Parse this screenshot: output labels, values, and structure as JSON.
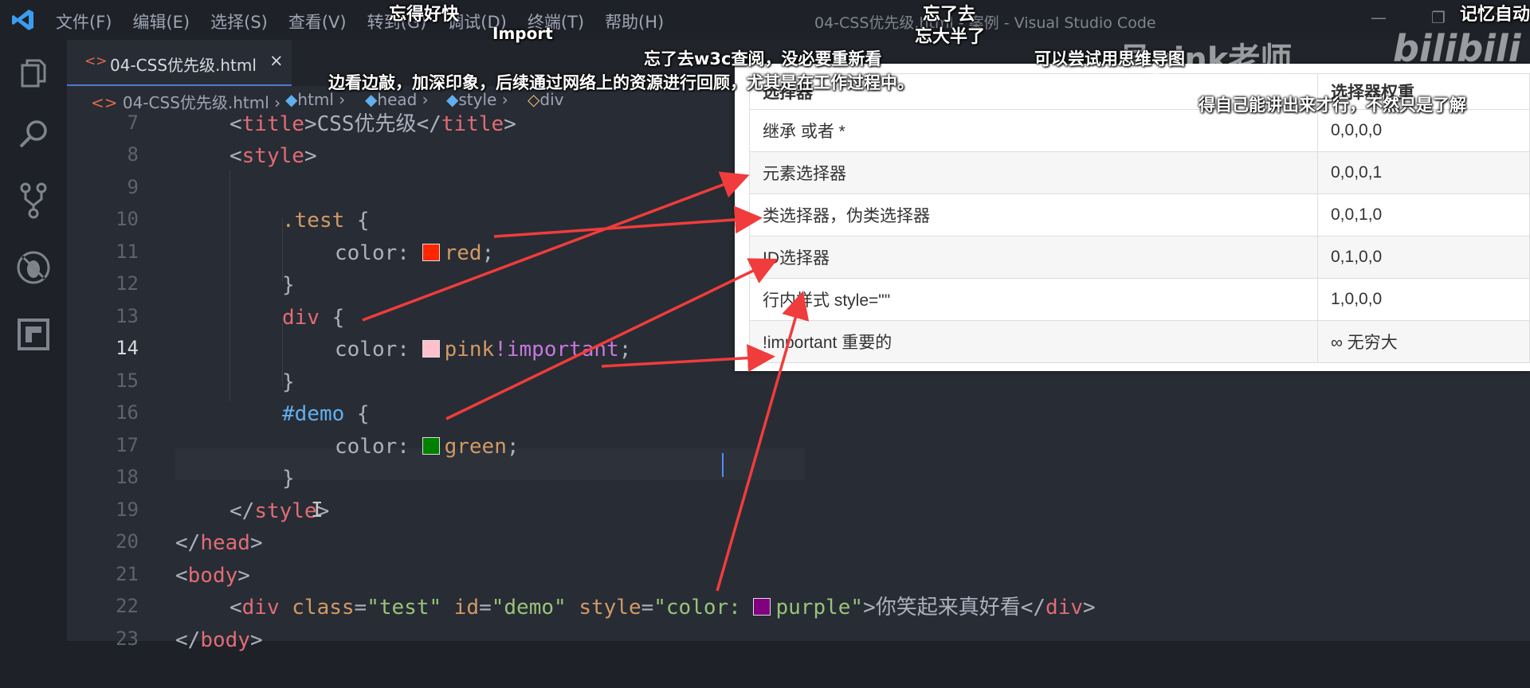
{
  "window": {
    "title": "04-CSS优先级.html - 案例 - Visual Studio Code",
    "menu": [
      "文件(F)",
      "编辑(E)",
      "选择(S)",
      "查看(V)",
      "转到(G)",
      "调试(D)",
      "终端(T)",
      "帮助(H)"
    ],
    "minimize": "—",
    "maximize": "❐",
    "close": "✕"
  },
  "tab": {
    "icon": "<>",
    "name": "04-CSS优先级.html",
    "close": "×"
  },
  "breadcrumb": [
    {
      "icon": "<>",
      "label": "04-CSS优先级.html"
    },
    {
      "icon": "◆",
      "label": "html"
    },
    {
      "icon": "◆",
      "label": "head"
    },
    {
      "icon": "◆",
      "label": "style"
    },
    {
      "icon": "◇",
      "label": "div"
    }
  ],
  "editor": {
    "line_numbers": [
      "7",
      "8",
      "9",
      "10",
      "11",
      "12",
      "13",
      "14",
      "15",
      "16",
      "17",
      "18",
      "19",
      "20",
      "21",
      "22",
      "23"
    ],
    "active_line": "14",
    "code": {
      "l7": {
        "open": "<",
        "tag": "title",
        "close": ">",
        "text": "CSS优先级",
        "end_open": "</",
        "end_tag": "title",
        "end_close": ">"
      },
      "l8": {
        "open": "<",
        "tag": "style",
        "close": ">"
      },
      "l10": {
        "sel": ".test",
        "brace": " {"
      },
      "l11": {
        "prop": "color: ",
        "val": "red",
        "semi": ";",
        "swatch": "#ff2600"
      },
      "l12": {
        "brace": "}"
      },
      "l13": {
        "sel": "div",
        "brace": " {"
      },
      "l14": {
        "prop": "color: ",
        "val": "pink",
        "imp": "!important",
        "semi": ";",
        "swatch": "#ffc0cb"
      },
      "l15": {
        "brace": "}"
      },
      "l16": {
        "sel": "#demo",
        "brace": " {"
      },
      "l17": {
        "prop": "color: ",
        "val": "green",
        "semi": ";",
        "swatch": "#008000"
      },
      "l18": {
        "brace": "}"
      },
      "l19": {
        "open": "</",
        "tag": "style",
        "close": ">"
      },
      "l20": {
        "open": "</",
        "tag": "head",
        "close": ">"
      },
      "l21": {
        "open": "<",
        "tag": "body",
        "close": ">"
      },
      "l22": {
        "open": "<",
        "tag": "div",
        "a1": " class",
        "eq1": "=",
        "v1": "\"test\"",
        "a2": " id",
        "eq2": "=",
        "v2": "\"demo\"",
        "a3": " style",
        "eq3": "=",
        "v3a": "\"color: ",
        "v3b": "purple\"",
        "swatch": "#800080",
        "close": ">",
        "text": "你笑起来真好看",
        "end_open": "</",
        "end_tag": "div",
        "end_close": ">"
      },
      "l23": {
        "open": "</",
        "tag": "body",
        "close": ">"
      }
    }
  },
  "specificity_table": {
    "headers": [
      "选择器",
      "选择器权重"
    ],
    "rows": [
      [
        "继承 或者 *",
        "0,0,0,0"
      ],
      [
        "元素选择器",
        "0,0,0,1"
      ],
      [
        "类选择器，伪类选择器",
        "0,0,1,0"
      ],
      [
        "ID选择器",
        "0,1,0,0"
      ],
      [
        "行内样式 style=\"\"",
        "1,0,0,0"
      ],
      [
        "!important  重要的",
        "∞ 无穷大"
      ]
    ]
  },
  "danmaku": [
    "忘得好快",
    "Import",
    "忘了去",
    "忘大半了",
    "记忆自动",
    "忘了去w3c查阅，没必要重新看",
    "可以尝试用思维导图",
    "边看边敲，加深印象，后续通过网络上的资源进行回顾，尤其是在工作过程中。",
    "得自己能讲出来才行，不然只是了解"
  ],
  "watermark": {
    "author": "员pink老师",
    "site": "bilibili"
  },
  "colors": {
    "arrow": "#f03c3c",
    "accent": "#4d78cc"
  }
}
